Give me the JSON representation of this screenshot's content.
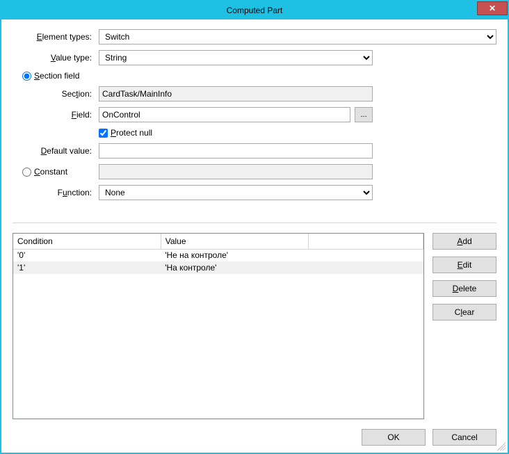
{
  "window": {
    "title": "Computed Part",
    "close": "✕"
  },
  "labels": {
    "element_types": "Element types:",
    "value_type": "Value type:",
    "section_field": "Section field",
    "section": "Section:",
    "field": "Field:",
    "protect_null": "Protect null",
    "default_value": "Default value:",
    "constant": "Constant",
    "function": "Function:"
  },
  "underline": {
    "element_types": "E",
    "value_type": "V",
    "section_field": "S",
    "section": "t",
    "field": "F",
    "protect_null": "P",
    "default_value": "D",
    "constant": "C",
    "function": "u",
    "add": "A",
    "edit": "E",
    "delete": "D",
    "clear": "l"
  },
  "fields": {
    "element_types": "Switch",
    "value_type": "String",
    "section": "CardTask/MainInfo",
    "field": "OnControl",
    "protect_null_checked": true,
    "default_value": "",
    "constant": "",
    "function": "None",
    "radio_section_field": true,
    "radio_constant": false
  },
  "browse": "...",
  "table": {
    "headers": {
      "condition": "Condition",
      "value": "Value"
    },
    "rows": [
      {
        "condition": "'0'",
        "value": "'Не на контроле'"
      },
      {
        "condition": "'1'",
        "value": "'На контроле'"
      }
    ],
    "selected_index": 1
  },
  "buttons": {
    "add": "Add",
    "edit": "Edit",
    "delete": "Delete",
    "clear": "Clear",
    "ok": "OK",
    "cancel": "Cancel"
  }
}
